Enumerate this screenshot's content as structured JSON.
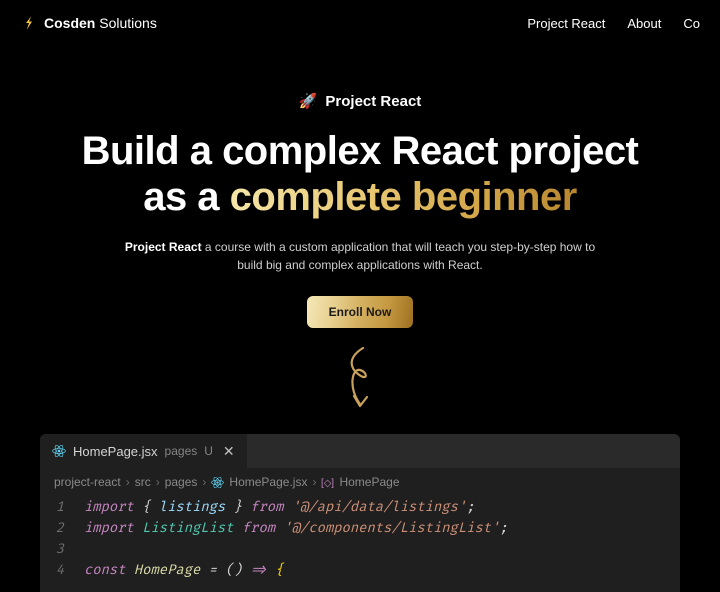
{
  "header": {
    "brand": {
      "bold": "Cosden",
      "rest": " Solutions"
    },
    "nav": [
      "Project React",
      "About",
      "Co"
    ]
  },
  "hero": {
    "badge": "Project React",
    "title_l1": "Build a complex React project",
    "title_l2a": "as a ",
    "title_l2b": "complete beginner",
    "sub_bold": "Project React",
    "sub_rest": " a course with a custom application that will teach you step-by-step how to build big and complex applications with React.",
    "cta": "Enroll Now"
  },
  "editor": {
    "tab": {
      "file": "HomePage.jsx",
      "folder": "pages",
      "status": "U"
    },
    "breadcrumb": [
      "project-react",
      "src",
      "pages",
      "HomePage.jsx",
      "HomePage"
    ],
    "code": [
      {
        "n": "1",
        "tokens": [
          {
            "c": "kw",
            "t": "import "
          },
          {
            "c": "pn",
            "t": "{ "
          },
          {
            "c": "vr",
            "t": "listings"
          },
          {
            "c": "pn",
            "t": " } "
          },
          {
            "c": "kw",
            "t": "from "
          },
          {
            "c": "st",
            "t": "'@/api/data/listings'"
          },
          {
            "c": "pn",
            "t": ";"
          }
        ]
      },
      {
        "n": "2",
        "tokens": [
          {
            "c": "kw",
            "t": "import "
          },
          {
            "c": "cl",
            "t": "ListingList"
          },
          {
            "c": "kw",
            "t": " from "
          },
          {
            "c": "st",
            "t": "'@/components/ListingList'"
          },
          {
            "c": "pn",
            "t": ";"
          }
        ]
      },
      {
        "n": "3",
        "tokens": []
      },
      {
        "n": "4",
        "tokens": [
          {
            "c": "kw",
            "t": "const "
          },
          {
            "c": "fn",
            "t": "HomePage "
          },
          {
            "c": "pn",
            "t": "= () "
          },
          {
            "c": "kw",
            "t": "=> "
          },
          {
            "c": "br",
            "t": "{"
          }
        ]
      }
    ]
  }
}
